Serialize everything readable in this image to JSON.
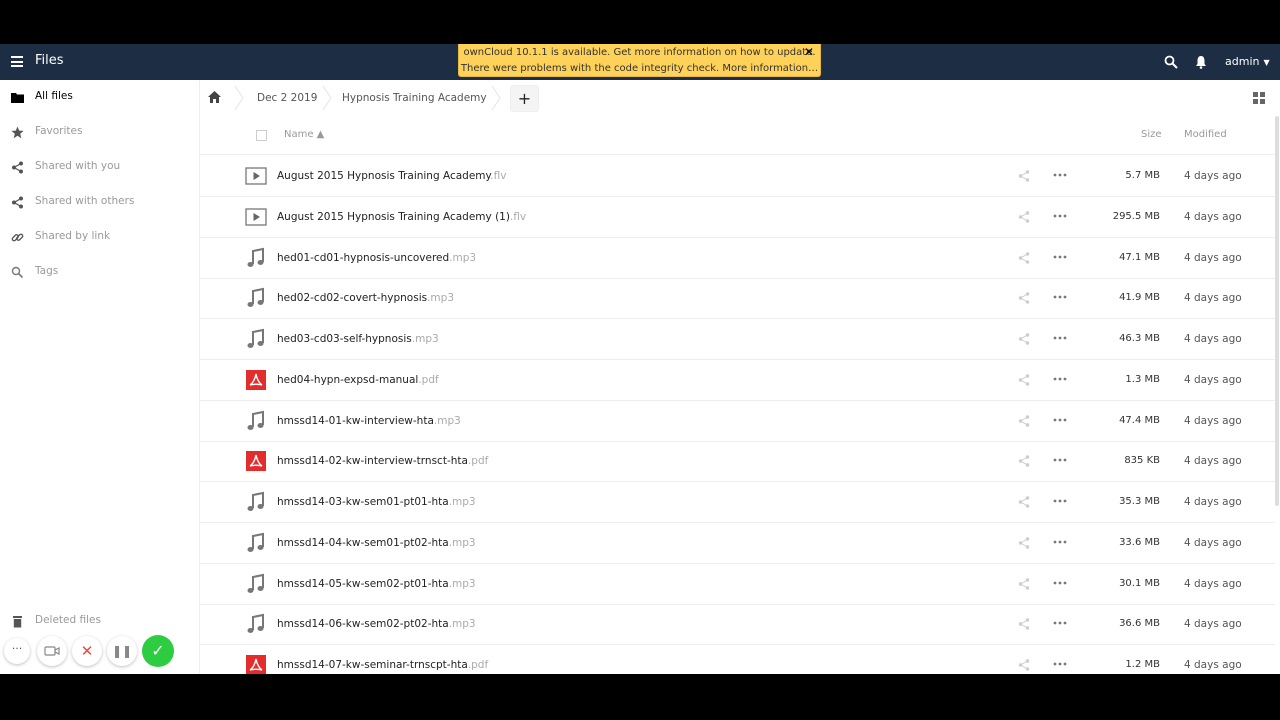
{
  "header": {
    "app_title": "Files",
    "user": "admin",
    "notice_line1": "ownCloud 10.1.1 is available. Get more information on how to update.",
    "notice_line2": "There were problems with the code integrity check. More information…"
  },
  "sidebar": {
    "items": [
      {
        "label": "All files",
        "icon": "folder-icon"
      },
      {
        "label": "Favorites",
        "icon": "star-icon"
      },
      {
        "label": "Shared with you",
        "icon": "share-icon"
      },
      {
        "label": "Shared with others",
        "icon": "share-icon"
      },
      {
        "label": "Shared by link",
        "icon": "link-icon"
      },
      {
        "label": "Tags",
        "icon": "tag-icon"
      }
    ],
    "deleted": "Deleted files"
  },
  "breadcrumb": {
    "items": [
      "Dec 2 2019",
      "Hypnosis Training Academy"
    ],
    "add_label": "+"
  },
  "list": {
    "header_name": "Name ▲",
    "header_size": "Size",
    "header_modified": "Modified",
    "files": [
      {
        "name": "August 2015 Hypnosis Training Academy",
        "ext": ".flv",
        "type": "video",
        "size": "5.7 MB",
        "modified": "4 days ago"
      },
      {
        "name": "August 2015 Hypnosis Training Academy (1)",
        "ext": ".flv",
        "type": "video",
        "size": "295.5 MB",
        "modified": "4 days ago"
      },
      {
        "name": "hed01-cd01-hypnosis-uncovered",
        "ext": ".mp3",
        "type": "audio",
        "size": "47.1 MB",
        "modified": "4 days ago"
      },
      {
        "name": "hed02-cd02-covert-hypnosis",
        "ext": ".mp3",
        "type": "audio",
        "size": "41.9 MB",
        "modified": "4 days ago"
      },
      {
        "name": "hed03-cd03-self-hypnosis",
        "ext": ".mp3",
        "type": "audio",
        "size": "46.3 MB",
        "modified": "4 days ago"
      },
      {
        "name": "hed04-hypn-expsd-manual",
        "ext": ".pdf",
        "type": "pdf",
        "size": "1.3 MB",
        "modified": "4 days ago"
      },
      {
        "name": "hmssd14-01-kw-interview-hta",
        "ext": ".mp3",
        "type": "audio",
        "size": "47.4 MB",
        "modified": "4 days ago"
      },
      {
        "name": "hmssd14-02-kw-interview-trnsct-hta",
        "ext": ".pdf",
        "type": "pdf",
        "size": "835 KB",
        "modified": "4 days ago"
      },
      {
        "name": "hmssd14-03-kw-sem01-pt01-hta",
        "ext": ".mp3",
        "type": "audio",
        "size": "35.3 MB",
        "modified": "4 days ago"
      },
      {
        "name": "hmssd14-04-kw-sem01-pt02-hta",
        "ext": ".mp3",
        "type": "audio",
        "size": "33.6 MB",
        "modified": "4 days ago"
      },
      {
        "name": "hmssd14-05-kw-sem02-pt01-hta",
        "ext": ".mp3",
        "type": "audio",
        "size": "30.1 MB",
        "modified": "4 days ago"
      },
      {
        "name": "hmssd14-06-kw-sem02-pt02-hta",
        "ext": ".mp3",
        "type": "audio",
        "size": "36.6 MB",
        "modified": "4 days ago"
      },
      {
        "name": "hmssd14-07-kw-seminar-trnscpt-hta",
        "ext": ".pdf",
        "type": "pdf",
        "size": "1.2 MB",
        "modified": "4 days ago"
      }
    ]
  },
  "colors": {
    "header_bg": "#1d2d44",
    "notice_bg": "#fed159",
    "pdf_red": "#e32d2d",
    "confirm_green": "#2ecc40"
  }
}
